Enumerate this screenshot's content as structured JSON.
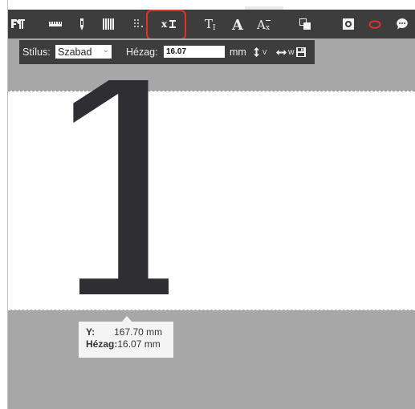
{
  "toolbar": {
    "items": [
      {
        "icon": "paragraph-format-icon"
      },
      {
        "icon": "ruler-icon"
      },
      {
        "icon": "pen-icon"
      },
      {
        "icon": "columns-icon"
      },
      {
        "icon": "grid-dots-icon"
      },
      {
        "icon": "baseline-spacing-icon",
        "label": "x",
        "active": true
      },
      {
        "icon": "text-size-icon",
        "label": "TT"
      },
      {
        "icon": "font-icon",
        "label": "A"
      },
      {
        "icon": "font-accent-icon",
        "label": "Ax"
      },
      {
        "icon": "layer-icon"
      },
      {
        "icon": "frame-icon"
      },
      {
        "icon": "ellipse-icon"
      },
      {
        "icon": "comment-icon"
      }
    ],
    "highlight_color": "#e03131"
  },
  "subbar": {
    "style_label": "Stílus:",
    "style_value": "Szabad",
    "gap_label": "Hézag:",
    "gap_value": "16.07",
    "unit": "mm",
    "v_label": "V",
    "w_label": "W"
  },
  "canvas": {
    "glyph": "1"
  },
  "tooltip": {
    "y_label": "Y:",
    "y_value": "167.70 mm",
    "gap_label": "Hézag:",
    "gap_value": "16.07 mm"
  },
  "colors": {
    "toolbar_bg": "#3d3d3d",
    "canvas_bg": "#a7a7a7",
    "ellipse_accent": "#e03131"
  }
}
